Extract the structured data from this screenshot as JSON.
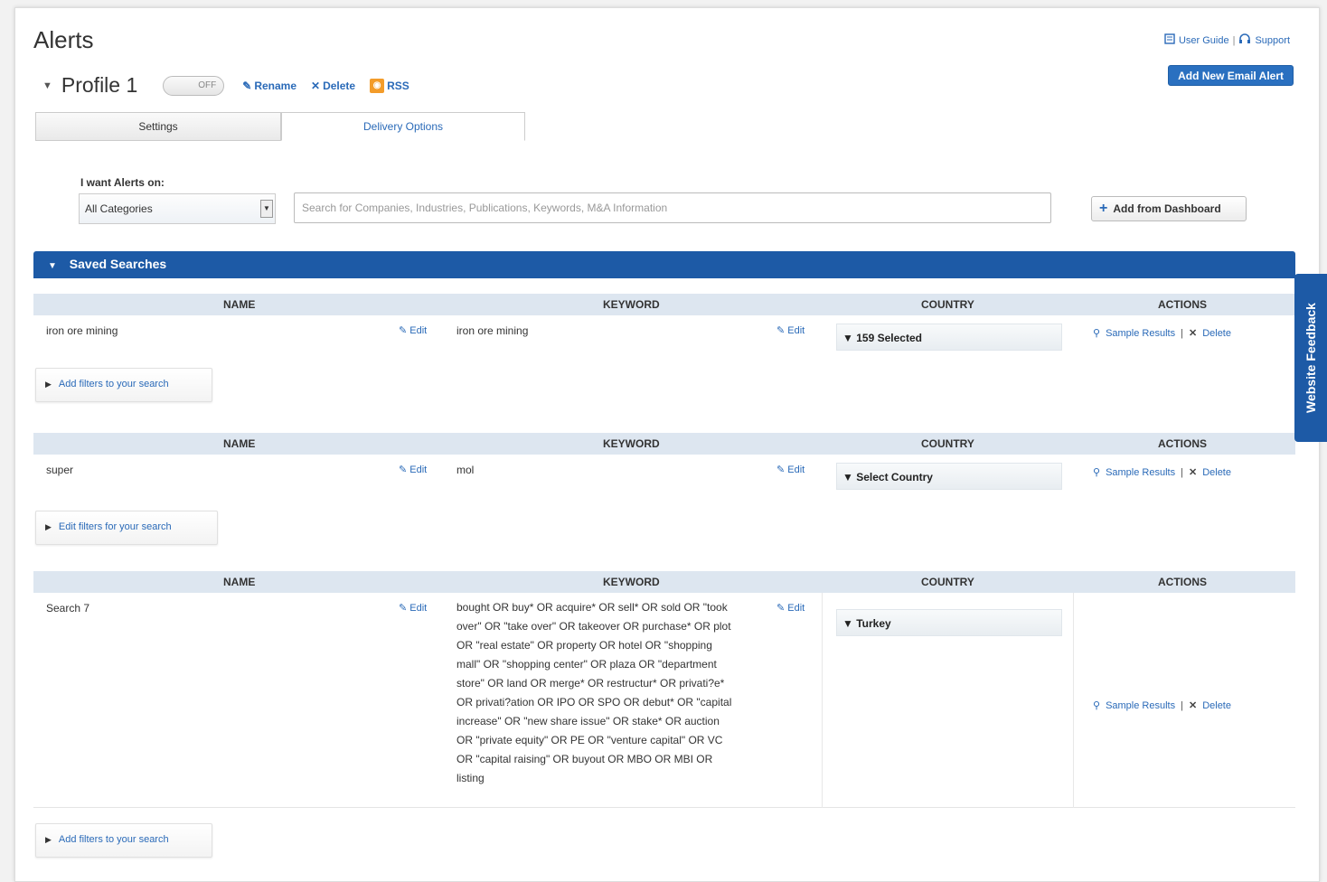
{
  "page": {
    "title": "Alerts"
  },
  "top_links": {
    "user_guide": "User Guide",
    "support": "Support"
  },
  "add_alert_button": "Add New Email Alert",
  "profile": {
    "name": "Profile 1",
    "toggle": "OFF",
    "rename": "Rename",
    "delete": "Delete",
    "rss": "RSS"
  },
  "tabs": [
    {
      "label": "Settings"
    },
    {
      "label": "Delivery Options"
    }
  ],
  "alert_on": {
    "label": "I want Alerts on:",
    "category": "All Categories",
    "search_placeholder": "Search for Companies, Industries, Publications, Keywords, M&A Information",
    "add_from_dashboard": "Add from Dashboard"
  },
  "saved_searches": {
    "title": "Saved Searches",
    "headers": {
      "name": "NAME",
      "keyword": "KEYWORD",
      "country": "COUNTRY",
      "actions": "ACTIONS"
    },
    "edit_label": "Edit",
    "sample_results": "Sample Results",
    "delete_label": "Delete",
    "rows": [
      {
        "name": "iron ore mining",
        "keyword": "iron ore mining",
        "country": "159 Selected",
        "filter": "Add filters to your search"
      },
      {
        "name": "super",
        "keyword": "mol",
        "country": "Select Country",
        "filter": "Edit filters for your search"
      },
      {
        "name": "Search 7",
        "keyword": "bought OR buy* OR acquire* OR sell* OR sold OR \"took over\" OR \"take over\" OR takeover OR purchase* OR plot OR \"real estate\" OR property OR hotel OR \"shopping mall\" OR \"shopping center\" OR plaza OR \"department store\" OR land OR merge* OR restructur* OR privati?e* OR privati?ation OR IPO OR SPO OR debut* OR \"capital increase\" OR \"new share issue\" OR stake* OR auction OR \"private equity\" OR PE OR \"venture capital\" OR VC OR \"capital raising\" OR buyout OR MBO OR MBI OR listing",
        "country": "Turkey",
        "filter": "Add filters to your search"
      }
    ]
  },
  "feedback_tab": "Website Feedback"
}
